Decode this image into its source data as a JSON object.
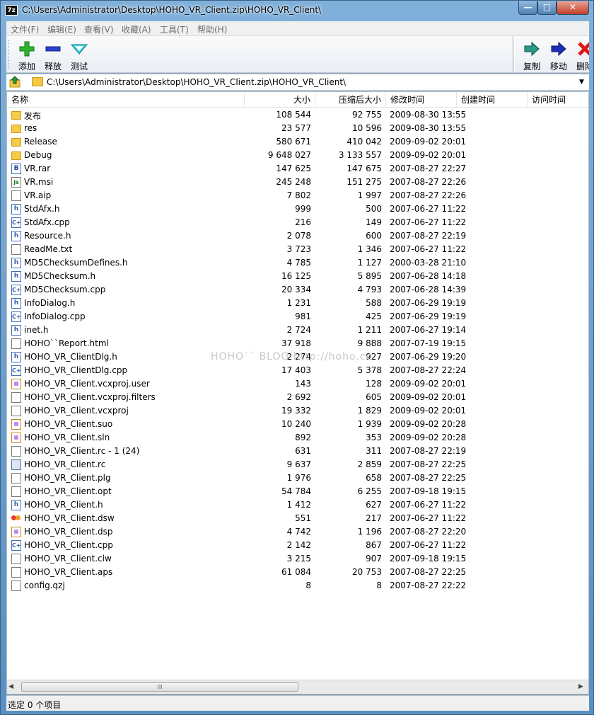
{
  "window": {
    "app_icon": "7z",
    "title": "C:\\Users\\Administrator\\Desktop\\HOHO_VR_Client.zip\\HOHO_VR_Client\\",
    "minimize": "—",
    "maximize": "□",
    "close": "✕"
  },
  "menu": [
    "文件(F)",
    "编辑(E)",
    "查看(V)",
    "收藏(A)",
    "工具(T)",
    "帮助(H)"
  ],
  "toolbar": {
    "add": "添加",
    "extract": "释放",
    "test": "测试",
    "copy": "复制",
    "move": "移动",
    "delete": "删除"
  },
  "address": {
    "path": "C:\\Users\\Administrator\\Desktop\\HOHO_VR_Client.zip\\HOHO_VR_Client\\"
  },
  "columns": {
    "name": "名称",
    "size": "大小",
    "packed": "压缩后大小",
    "modified": "修改时间",
    "created": "创建时间",
    "accessed": "访问时间"
  },
  "files": [
    {
      "name": "发布",
      "size": "108 544",
      "packed": "92 755",
      "modified": "2009-08-30 13:55",
      "icon": "folder-icon"
    },
    {
      "name": "res",
      "size": "23 577",
      "packed": "10 596",
      "modified": "2009-08-30 13:55",
      "icon": "folder-icon"
    },
    {
      "name": "Release",
      "size": "580 671",
      "packed": "410 042",
      "modified": "2009-09-02 20:01",
      "icon": "folder-icon"
    },
    {
      "name": "Debug",
      "size": "9 648 027",
      "packed": "3 133 557",
      "modified": "2009-09-02 20:01",
      "icon": "folder-icon"
    },
    {
      "name": "VR.rar",
      "size": "147 625",
      "packed": "147 675",
      "modified": "2007-08-27 22:27",
      "icon": "rar-icon"
    },
    {
      "name": "VR.msi",
      "size": "245 248",
      "packed": "151 275",
      "modified": "2007-08-27 22:26",
      "icon": "msi-icon"
    },
    {
      "name": "VR.aip",
      "size": "7 802",
      "packed": "1 997",
      "modified": "2007-08-27 22:26",
      "icon": "file-icon"
    },
    {
      "name": "StdAfx.h",
      "size": "999",
      "packed": "500",
      "modified": "2007-06-27 11:22",
      "icon": "h-file-icon"
    },
    {
      "name": "StdAfx.cpp",
      "size": "216",
      "packed": "149",
      "modified": "2007-06-27 11:22",
      "icon": "cpp-file-icon"
    },
    {
      "name": "Resource.h",
      "size": "2 078",
      "packed": "600",
      "modified": "2007-08-27 22:19",
      "icon": "h-file-icon"
    },
    {
      "name": "ReadMe.txt",
      "size": "3 723",
      "packed": "1 346",
      "modified": "2007-06-27 11:22",
      "icon": "file-icon"
    },
    {
      "name": "MD5ChecksumDefines.h",
      "size": "4 785",
      "packed": "1 127",
      "modified": "2000-03-28 21:10",
      "icon": "h-file-icon"
    },
    {
      "name": "MD5Checksum.h",
      "size": "16 125",
      "packed": "5 895",
      "modified": "2007-06-28 14:18",
      "icon": "h-file-icon"
    },
    {
      "name": "MD5Checksum.cpp",
      "size": "20 334",
      "packed": "4 793",
      "modified": "2007-06-28 14:39",
      "icon": "cpp-file-icon"
    },
    {
      "name": "InfoDialog.h",
      "size": "1 231",
      "packed": "588",
      "modified": "2007-06-29 19:19",
      "icon": "h-file-icon"
    },
    {
      "name": "InfoDialog.cpp",
      "size": "981",
      "packed": "425",
      "modified": "2007-06-29 19:19",
      "icon": "cpp-file-icon"
    },
    {
      "name": "inet.h",
      "size": "2 724",
      "packed": "1 211",
      "modified": "2007-06-27 19:14",
      "icon": "h-file-icon"
    },
    {
      "name": "HOHO``Report.html",
      "size": "37 918",
      "packed": "9 888",
      "modified": "2007-07-19 19:15",
      "icon": "file-icon"
    },
    {
      "name": "HOHO_VR_ClientDlg.h",
      "size": "2 274",
      "packed": "927",
      "modified": "2007-06-29 19:20",
      "icon": "h-file-icon"
    },
    {
      "name": "HOHO_VR_ClientDlg.cpp",
      "size": "17 403",
      "packed": "5 378",
      "modified": "2007-08-27 22:24",
      "icon": "cpp-file-icon"
    },
    {
      "name": "HOHO_VR_Client.vcxproj.user",
      "size": "143",
      "packed": "128",
      "modified": "2009-09-02 20:01",
      "icon": "vs-file-icon"
    },
    {
      "name": "HOHO_VR_Client.vcxproj.filters",
      "size": "2 692",
      "packed": "605",
      "modified": "2009-09-02 20:01",
      "icon": "file-icon"
    },
    {
      "name": "HOHO_VR_Client.vcxproj",
      "size": "19 332",
      "packed": "1 829",
      "modified": "2009-09-02 20:01",
      "icon": "file-icon"
    },
    {
      "name": "HOHO_VR_Client.suo",
      "size": "10 240",
      "packed": "1 939",
      "modified": "2009-09-02 20:28",
      "icon": "vs-file-icon"
    },
    {
      "name": "HOHO_VR_Client.sln",
      "size": "892",
      "packed": "353",
      "modified": "2009-09-02 20:28",
      "icon": "vs-file-icon"
    },
    {
      "name": "HOHO_VR_Client.rc - 1 (24)",
      "size": "631",
      "packed": "311",
      "modified": "2007-08-27 22:19",
      "icon": "file-icon"
    },
    {
      "name": "HOHO_VR_Client.rc",
      "size": "9 637",
      "packed": "2 859",
      "modified": "2007-08-27 22:25",
      "icon": "rc-file-icon"
    },
    {
      "name": "HOHO_VR_Client.plg",
      "size": "1 976",
      "packed": "658",
      "modified": "2007-08-27 22:25",
      "icon": "file-icon"
    },
    {
      "name": "HOHO_VR_Client.opt",
      "size": "54 784",
      "packed": "6 255",
      "modified": "2007-09-18 19:15",
      "icon": "file-icon"
    },
    {
      "name": "HOHO_VR_Client.h",
      "size": "1 412",
      "packed": "627",
      "modified": "2007-06-27 11:22",
      "icon": "h-file-icon"
    },
    {
      "name": "HOHO_VR_Client.dsw",
      "size": "551",
      "packed": "217",
      "modified": "2007-06-27 11:22",
      "icon": "dsw-file-icon"
    },
    {
      "name": "HOHO_VR_Client.dsp",
      "size": "4 742",
      "packed": "1 196",
      "modified": "2007-08-27 22:20",
      "icon": "vs-file-icon"
    },
    {
      "name": "HOHO_VR_Client.cpp",
      "size": "2 142",
      "packed": "867",
      "modified": "2007-06-27 11:22",
      "icon": "cpp-file-icon"
    },
    {
      "name": "HOHO_VR_Client.clw",
      "size": "3 215",
      "packed": "907",
      "modified": "2007-09-18 19:15",
      "icon": "file-icon"
    },
    {
      "name": "HOHO_VR_Client.aps",
      "size": "61 084",
      "packed": "20 753",
      "modified": "2007-08-27 22:25",
      "icon": "file-icon"
    },
    {
      "name": "config.qzj",
      "size": "8",
      "packed": "8",
      "modified": "2007-08-27 22:22",
      "icon": "file-icon"
    }
  ],
  "watermark": "HOHO`` BLOG  http://hoho.cc",
  "scrollbar": {
    "thumb_grip": "III"
  },
  "status": "选定 0 个项目"
}
